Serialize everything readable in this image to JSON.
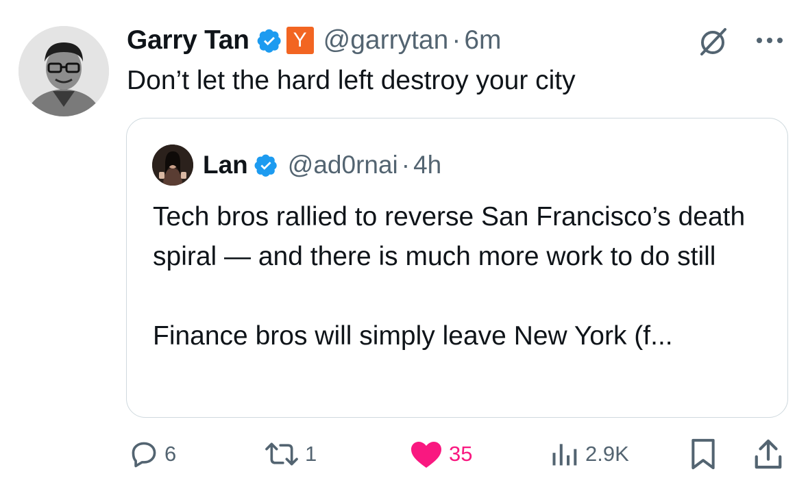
{
  "tweet": {
    "author_name": "Garry Tan",
    "yc_badge": "Y",
    "handle": "@garrytan",
    "separator": "·",
    "time": "6m",
    "text": "Don’t let the hard left destroy your city"
  },
  "quoted": {
    "author_name": "Lan",
    "handle": "@ad0rnai",
    "separator": "·",
    "time": "4h",
    "paragraph_1": "Tech bros rallied to reverse San Francisco’s death spiral — and there is much more work to do still",
    "paragraph_2": "Finance bros will simply leave New York (f..."
  },
  "actions": {
    "replies": "6",
    "reposts": "1",
    "likes": "35",
    "views": "2.9K"
  },
  "colors": {
    "verified_blue": "#1d9bf0",
    "yc_orange": "#f26522",
    "like_pink": "#f91880",
    "secondary_text": "#536471",
    "border": "#cfd9de"
  },
  "icons": [
    "verified-badge-icon",
    "yc-badge-icon",
    "grok-icon",
    "more-icon",
    "reply-icon",
    "repost-icon",
    "like-icon",
    "views-icon",
    "bookmark-icon",
    "share-icon"
  ]
}
